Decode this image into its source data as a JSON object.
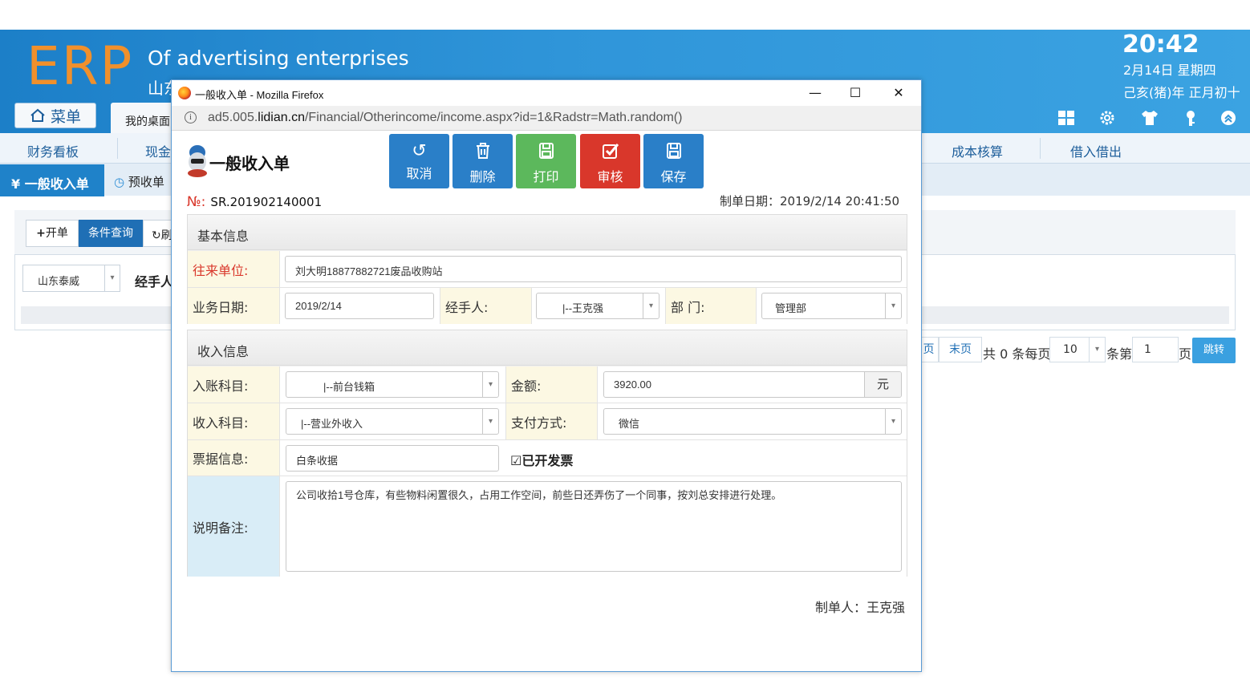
{
  "erp": {
    "logo": "ERP",
    "title": "Of advertising enterprises",
    "subtitle": "山东",
    "menu_button": "菜单",
    "desktop_tab": "我的桌面",
    "clock": {
      "time": "20:42",
      "date": "2月14日 星期四",
      "lunar": "己亥(猪)年 正月初十"
    },
    "toolbar_icons": [
      "grid-icon",
      "gear-icon",
      "shirt-icon",
      "key-icon",
      "chevron-up-icon"
    ],
    "nav": [
      "财务看板",
      "现金",
      "成本核算",
      "借入借出"
    ],
    "tabs": {
      "active": "一般收入单",
      "second": "预收单"
    },
    "work_toolbar": {
      "new": "开单",
      "query": "条件查询",
      "refresh": "刷"
    },
    "company_select": "山东泰威",
    "handler_label": "经手人",
    "pager": {
      "prev": "页",
      "last": "末页",
      "total": "共 0 条每页",
      "per_page": "10",
      "items_label": "条第",
      "page": "1",
      "page_suffix": "页",
      "goto": "跳转"
    }
  },
  "popup": {
    "window_title": "一般收入单 - Mozilla Firefox",
    "controls": {
      "minimize": "—",
      "maximize": "☐",
      "close": "✕"
    },
    "url_prefix": "ad5.005.",
    "url_domain": "lidian.cn",
    "url_path": "/Financial/Otherincome/income.aspx?id=1&Radstr=Math.random()",
    "doc_title": "一般收入单",
    "actions": [
      {
        "label": "取消",
        "icon": "undo-icon",
        "color": "#2a7fc8"
      },
      {
        "label": "删除",
        "icon": "trash-icon",
        "color": "#2a7fc8"
      },
      {
        "label": "打印",
        "icon": "save-icon",
        "color": "#5cb85c"
      },
      {
        "label": "审核",
        "icon": "check-icon",
        "color": "#d9372b"
      },
      {
        "label": "保存",
        "icon": "save-icon",
        "color": "#2a7fc8"
      }
    ],
    "doc_no_mark": "№:",
    "doc_no": "SR.201902140001",
    "doc_date": "制单日期：2019/2/14 20:41:50",
    "basic": {
      "head": "基本信息",
      "partner_label": "往来单位:",
      "partner_value": "刘大明18877882721废品收购站",
      "date_label": "业务日期:",
      "date_value": "2019/2/14",
      "handler_label": "经手人:",
      "handler_value": "|--王克强",
      "dept_label": "部  门:",
      "dept_value": "管理部"
    },
    "income": {
      "head": "收入信息",
      "account_label": "入账科目:",
      "account_value": "|--前台钱箱",
      "amount_label": "金额:",
      "amount_value": "3920.00",
      "amount_unit": "元",
      "subject_label": "收入科目:",
      "subject_value": "|--营业外收入",
      "pay_label": "支付方式:",
      "pay_value": "微信",
      "bill_label": "票据信息:",
      "bill_value": "白条收据",
      "invoice_check": "☑",
      "invoice_label": "已开发票",
      "remark_label": "说明备注:",
      "remark_value": "公司收拾1号仓库，有些物料闲置很久，占用工作空间，前些日还弄伤了一个同事，按刘总安排进行处理。"
    },
    "maker": "制单人：王克强"
  }
}
